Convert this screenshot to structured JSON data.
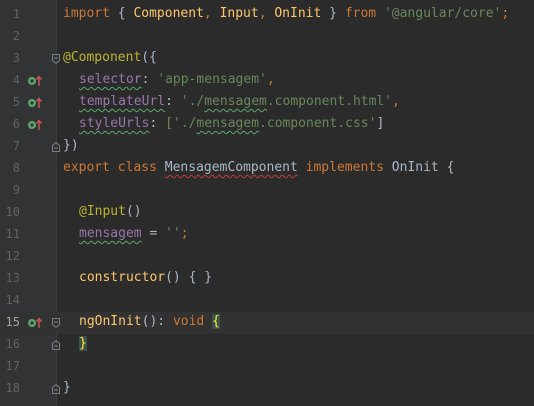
{
  "editor": {
    "lines": [
      {
        "num": "1"
      },
      {
        "num": "2"
      },
      {
        "num": "3"
      },
      {
        "num": "4"
      },
      {
        "num": "5"
      },
      {
        "num": "6"
      },
      {
        "num": "7"
      },
      {
        "num": "8"
      },
      {
        "num": "9"
      },
      {
        "num": "10"
      },
      {
        "num": "11"
      },
      {
        "num": "12"
      },
      {
        "num": "13"
      },
      {
        "num": "14"
      },
      {
        "num": "15"
      },
      {
        "num": "16"
      },
      {
        "num": "17"
      },
      {
        "num": "18"
      }
    ],
    "code": {
      "l1": {
        "import": "import",
        "b1": "{",
        "component": "Component",
        "c1": ",",
        "input": "Input",
        "c2": ",",
        "oninit": "OnInit",
        "b2": "}",
        "from": "from",
        "path": "'@angular/core'",
        "semi": ";"
      },
      "l3": {
        "dec": "@Component",
        "open": "({"
      },
      "l4": {
        "key": "selector",
        "colon": ":",
        "value": "'app-mensagem'",
        "comma": ","
      },
      "l5": {
        "key": "templateUrl",
        "colon": ":",
        "q1": "'./",
        "file": "mensagem",
        "rest": ".component.html'",
        "comma": ","
      },
      "l6": {
        "key": "styleUrls",
        "colon": ":",
        "open": "['./",
        "file": "mensagem",
        "rest": ".component.css'",
        "close": "]"
      },
      "l7": {
        "close": "})"
      },
      "l8": {
        "export": "export",
        "class": "class",
        "name": "MensagemComponent",
        "implements": "implements",
        "iface": "OnInit",
        "brace": "{"
      },
      "l10": {
        "dec": "@Input",
        "parens": "()"
      },
      "l11": {
        "prop": "mensagem",
        "eq": "=",
        "value": "''",
        "semi": ";"
      },
      "l13": {
        "ctor": "constructor",
        "rest": "() { }"
      },
      "l15": {
        "fn": "ngOnInit",
        "parens": "():",
        "type": "void",
        "brace": "{"
      },
      "l16": {
        "brace": "}"
      },
      "l18": {
        "brace": "}"
      }
    }
  },
  "colors": {
    "background": "#2b2b2b",
    "gutter": "#313335",
    "keyword": "#cc7832",
    "string": "#6a8759",
    "annotation": "#bbb529",
    "property": "#9876aa",
    "function": "#ffc66d",
    "text": "#a9b7c6",
    "brace_match": "#ffef28",
    "current_line": "#323232"
  },
  "icons": {
    "implements_marker": "implementing-method-icon",
    "fold": "fold-icon"
  }
}
